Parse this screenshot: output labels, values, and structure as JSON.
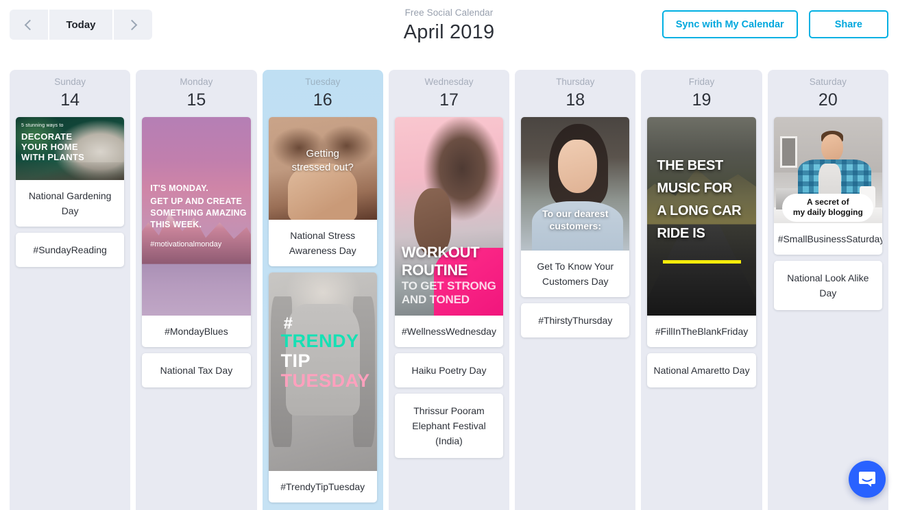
{
  "header": {
    "prev_label": "Previous",
    "today_label": "Today",
    "next_label": "Next",
    "subtitle": "Free Social Calendar",
    "title": "April 2019",
    "sync_label": "Sync with My Calendar",
    "share_label": "Share",
    "accent_color": "#00b0e3"
  },
  "chat": {
    "name": "intercom-chat-icon",
    "color": "#2962ff"
  },
  "columns": [
    {
      "day": "Sunday",
      "date": "14",
      "today": false,
      "cards": [
        {
          "type": "image",
          "image": "plants-decor-thumbnail",
          "overlay": {
            "l1": "5 stunning ways to",
            "l2": "DECORATE",
            "l3": "YOUR HOME",
            "l4": "WITH PLANTS"
          },
          "label": "National Gardening Day"
        },
        {
          "type": "text",
          "label": "#SundayReading"
        }
      ]
    },
    {
      "day": "Monday",
      "date": "15",
      "today": false,
      "cards": [
        {
          "type": "image",
          "image": "monday-motivation-mountain-thumbnail",
          "overlay": {
            "l1": "IT'S MONDAY.",
            "l2": "GET UP AND CREATE",
            "l3": "SOMETHING AMAZING",
            "l4": "THIS WEEK.",
            "l5": "#motivationalmonday"
          },
          "label": "#MondayBlues"
        },
        {
          "type": "text",
          "label": "National Tax Day"
        }
      ]
    },
    {
      "day": "Tuesday",
      "date": "16",
      "today": true,
      "cards": [
        {
          "type": "image",
          "image": "stressed-woman-thumbnail",
          "overlay": {
            "c1": "Getting",
            "c2": "stressed out?"
          },
          "label": "National Stress Awareness Day"
        },
        {
          "type": "image",
          "image": "trendy-tip-tuesday-thumbnail",
          "overlay": {
            "h": "#",
            "w1": "TRENDY",
            "w2": "TIP",
            "w3": "TUESDAY"
          },
          "label": "#TrendyTipTuesday"
        }
      ]
    },
    {
      "day": "Wednesday",
      "date": "17",
      "today": false,
      "cards": [
        {
          "type": "image",
          "image": "workout-routine-thumbnail",
          "overlay": {
            "w1": "WORKOUT",
            "w2": "ROUTINE",
            "w3": "TO GET STRONG",
            "w4": "AND TONED"
          },
          "label": "#WellnessWednesday"
        },
        {
          "type": "text",
          "label": "Haiku Poetry Day"
        },
        {
          "type": "text",
          "label": "Thrissur Pooram Elephant Festival (India)"
        }
      ]
    },
    {
      "day": "Thursday",
      "date": "18",
      "today": false,
      "cards": [
        {
          "type": "image",
          "image": "customer-portrait-thumbnail",
          "overlay": {
            "c1": "To our dearest",
            "c2": "customers:"
          },
          "label": "Get To Know Your Customers Day"
        },
        {
          "type": "text",
          "label": "#ThirstyThursday"
        }
      ]
    },
    {
      "day": "Friday",
      "date": "19",
      "today": false,
      "cards": [
        {
          "type": "image",
          "image": "car-ride-road-thumbnail",
          "overlay": {
            "r1": "THE BEST",
            "r2": "MUSIC FOR",
            "r3": "A LONG CAR",
            "r4": "RIDE IS"
          },
          "label": "#FillInTheBlankFriday"
        },
        {
          "type": "text",
          "label": "National Amaretto Day"
        }
      ]
    },
    {
      "day": "Saturday",
      "date": "20",
      "today": false,
      "cards": [
        {
          "type": "image",
          "image": "blogger-man-thumbnail",
          "overlay": {
            "b1": "A secret of",
            "b2": "my daily blogging"
          },
          "label": "#SmallBusinessSaturday"
        },
        {
          "type": "text",
          "label": "National Look Alike Day"
        }
      ]
    }
  ]
}
